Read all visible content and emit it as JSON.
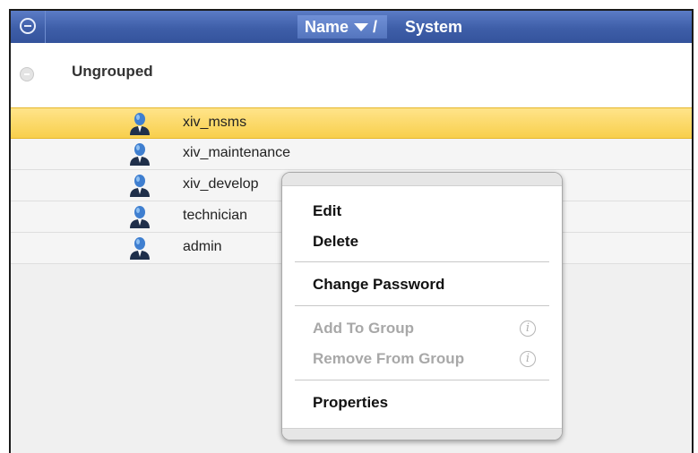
{
  "header": {
    "column_name": "Name",
    "column_separator": "/",
    "column_system": "System"
  },
  "group": {
    "label": "Ungrouped"
  },
  "users": [
    {
      "name": "xiv_msms",
      "selected": true
    },
    {
      "name": "xiv_maintenance",
      "selected": false
    },
    {
      "name": "xiv_develop",
      "selected": false
    },
    {
      "name": "technician",
      "selected": false
    },
    {
      "name": "admin",
      "selected": false
    }
  ],
  "context_menu": {
    "edit": "Edit",
    "delete": "Delete",
    "change_password": "Change Password",
    "add_to_group": "Add To Group",
    "remove_from_group": "Remove From Group",
    "properties": "Properties",
    "info_glyph": "i"
  },
  "colors": {
    "header_blue": "#3e5ea8",
    "selection_yellow": "#f8cf4c",
    "disabled_text": "#a8a8a8"
  },
  "icons": [
    "collapse-icon",
    "sort-descending-icon",
    "user-icon",
    "info-icon"
  ]
}
